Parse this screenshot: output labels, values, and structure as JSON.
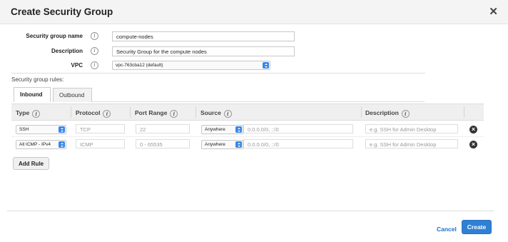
{
  "dialog": {
    "title": "Create Security Group",
    "close_glyph": "✕"
  },
  "form": {
    "name_label": "Security group name",
    "name_value": "compute-nodes",
    "description_label": "Description",
    "description_value": "Security Group for the compute nodes",
    "vpc_label": "VPC",
    "vpc_value": "vpc-763cba12 (default)",
    "info_glyph": "i"
  },
  "rules": {
    "section_label": "Security group rules:",
    "tabs": [
      {
        "label": "Inbound",
        "active": true
      },
      {
        "label": "Outbound",
        "active": false
      }
    ],
    "columns": [
      "Type",
      "Protocol",
      "Port Range",
      "Source",
      "Description"
    ],
    "rows": [
      {
        "type": "SSH",
        "protocol": "TCP",
        "port_range": "22",
        "source_select": "Anywhere",
        "source_value": "0.0.0.0/0, ::/0",
        "description_placeholder": "e.g. SSH for Admin Desktop"
      },
      {
        "type": "All ICMP - IPv4",
        "protocol": "ICMP",
        "port_range": "0 - 65535",
        "source_select": "Anywhere",
        "source_value": "0.0.0.0/0, ::/0",
        "description_placeholder": "e.g. SSH for Admin Desktop"
      }
    ],
    "delete_glyph": "×",
    "add_rule_label": "Add Rule"
  },
  "footer": {
    "cancel_label": "Cancel",
    "create_label": "Create"
  },
  "colors": {
    "accent": "#2f80d5",
    "link": "#1a6fc9",
    "select_button": "#3a87e6"
  },
  "icons": [
    "close-icon",
    "info-icon",
    "select-arrows-icon",
    "delete-rule-icon"
  ]
}
